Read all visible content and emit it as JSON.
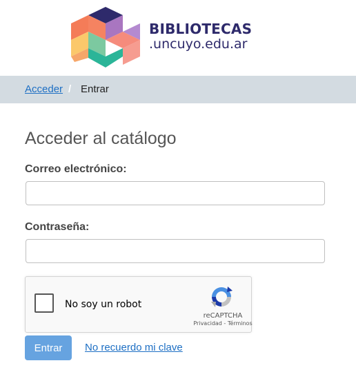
{
  "header": {
    "brand_main": "BIBLIOTECAS",
    "brand_sub": ".uncuyo.edu.ar",
    "colors": {
      "brand_text": "#2e2a6b",
      "cube_top_left": "#f47c58",
      "cube_top_right": "#a976c0",
      "cube_top": "#2e2a6b",
      "cube_left": "#fbc86b",
      "cube_right": "#f58b7c",
      "cube_bottom": "#2bb598"
    }
  },
  "breadcrumb": {
    "link": "Acceder",
    "separator": "/",
    "current": "Entrar",
    "background": "#d3dbe1"
  },
  "form": {
    "title": "Acceder al catálogo",
    "email_label": "Correo electrónico:",
    "email_value": "",
    "password_label": "Contraseña:",
    "password_value": "",
    "submit_label": "Entrar",
    "forgot_label": "No recuerdo mi clave",
    "submit_color": "#66a3e0",
    "link_color": "#1d6fc4"
  },
  "recaptcha": {
    "label": "No soy un robot",
    "brand": "reCAPTCHA",
    "privacy": "Privacidad",
    "terms_sep": " - ",
    "terms": "Términos",
    "icon": "recaptcha-logo"
  }
}
